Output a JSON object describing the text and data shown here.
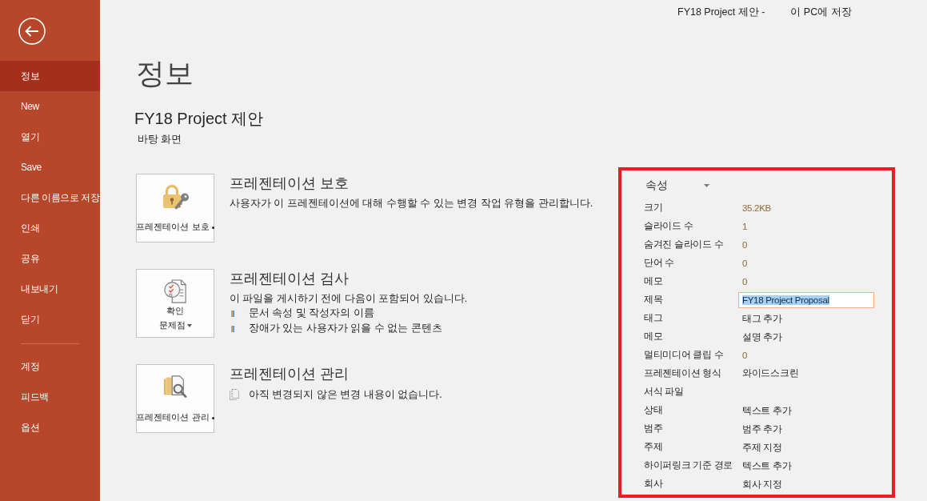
{
  "window": {
    "title": "FY18 Project 제안 -",
    "save_location": "이 PC에 저장"
  },
  "sidebar": {
    "sections": [
      {
        "items": [
          {
            "label": "정보",
            "selected": true
          },
          {
            "label": "New",
            "selected": false
          },
          {
            "label": "열기",
            "selected": false
          },
          {
            "label": "Save",
            "selected": false
          },
          {
            "label": "다른 이름으로 저장",
            "selected": false
          },
          {
            "label": "인쇄",
            "selected": false
          },
          {
            "label": "공유",
            "selected": false
          },
          {
            "label": "내보내기",
            "selected": false
          },
          {
            "label": "닫기",
            "selected": false
          }
        ]
      },
      {
        "items": [
          {
            "label": "계정",
            "selected": false
          },
          {
            "label": "피드백",
            "selected": false
          },
          {
            "label": "옵션",
            "selected": false
          }
        ]
      }
    ]
  },
  "page": {
    "heading": "정보",
    "document_title": "FY18 Project 제안",
    "document_location": "바탕 화면"
  },
  "sections": [
    {
      "kind": "protect",
      "button": {
        "label_lines": [
          "프레젠테이션 보호"
        ],
        "dot_marker": true
      },
      "title": "프레젠테이션 보호",
      "description": "사용자가 이 프레젠테이션에 대해 수행할 수 있는 변경 작업 유형을 관리합니다."
    },
    {
      "kind": "inspect",
      "button": {
        "label_lines": [
          "확인",
          "문제점"
        ],
        "caret_marker": true
      },
      "title": "프레젠테이션 검사",
      "description": "이 파일을 게시하기 전에 다음이 포함되어 있습니다.",
      "bullets": [
        "문서 속성 및 작성자의 이름",
        "장애가 있는 사용자가 읽을 수 없는 콘텐츠"
      ]
    },
    {
      "kind": "manage",
      "button": {
        "label_lines": [
          "프레젠테이션 관리"
        ],
        "dot_marker": true
      },
      "title": "프레젠테이션 관리",
      "note": "아직 변경되지 않은 변경 내용이 없습니다."
    }
  ],
  "properties": {
    "highlighted": true,
    "header": "속성",
    "rows": [
      {
        "label": "크기",
        "kind": "number",
        "value": "35.2KB"
      },
      {
        "label": "슬라이드 수",
        "kind": "number",
        "value": "1"
      },
      {
        "label": "숨겨진 슬라이드 수",
        "kind": "number",
        "value": "0"
      },
      {
        "label": "단어 수",
        "kind": "number",
        "value": "0"
      },
      {
        "label": "메모",
        "kind": "number",
        "value": "0"
      },
      {
        "label": "제목",
        "kind": "input",
        "value": "FY18 Project Proposal",
        "text_selected": true
      },
      {
        "label": "태그",
        "kind": "field",
        "placeholder": "태그 추가"
      },
      {
        "label": "메모",
        "kind": "field",
        "placeholder": "설명 추가"
      },
      {
        "label": "멀티미디어 클립 수",
        "kind": "number",
        "value": "0"
      },
      {
        "label": "프레젠테이션 형식",
        "kind": "text",
        "value": "와이드스크린"
      },
      {
        "label": "서식 파일",
        "kind": "text"
      },
      {
        "label": "상태",
        "kind": "field",
        "placeholder": "텍스트 추가"
      },
      {
        "label": "범주",
        "kind": "field",
        "placeholder": "범주 추가"
      },
      {
        "label": "주제",
        "kind": "field",
        "placeholder": "주제 지정"
      },
      {
        "label": "하이퍼링크 기준 경로",
        "kind": "field",
        "placeholder": "텍스트 추가"
      },
      {
        "label": "회사",
        "kind": "field",
        "placeholder": "회사 지정"
      }
    ]
  }
}
